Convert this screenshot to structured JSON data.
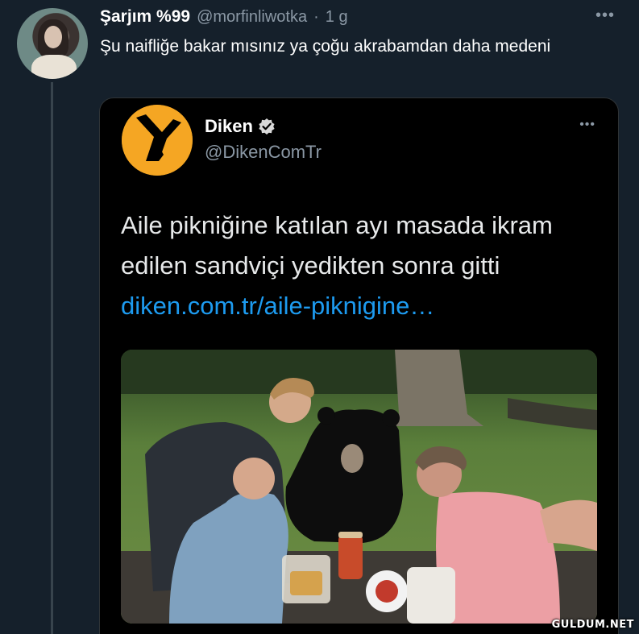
{
  "tweet": {
    "display_name": "Şarjım %99",
    "handle": "@morfinliwotka",
    "separator": "·",
    "time": "1 g",
    "more_icon": "more-horizontal-icon",
    "text": "Şu naifliğe bakar mısınız ya çoğu akrabamdan daha medeni"
  },
  "quoted": {
    "display_name": "Diken",
    "verified_icon": "verified-badge-icon",
    "handle": "@DikenComTr",
    "more_icon": "more-horizontal-icon",
    "text": "Aile pikniğine katılan ayı masada ikram edilen sandviçi yedikten sonra gitti",
    "link": "diken.com.tr/aile-piknigine…",
    "brand_color": "#f5a623",
    "link_color": "#1d9bf0"
  },
  "watermark": "GULDUM.NET",
  "colors": {
    "background": "#15202b",
    "secondary_text": "#8b98a5",
    "thread_line": "#38444d"
  }
}
